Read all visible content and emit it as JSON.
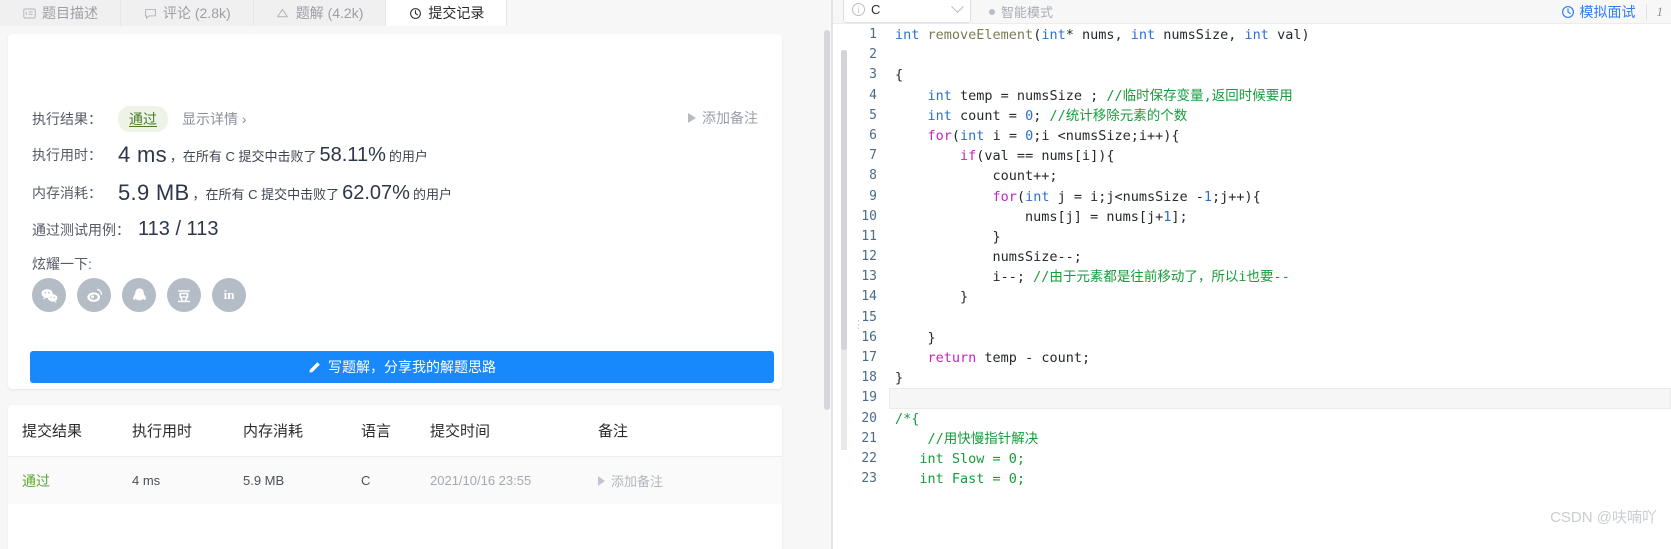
{
  "tabs": [
    {
      "label": "题目描述",
      "icon": "description-icon",
      "active": false
    },
    {
      "label": "评论 (2.8k)",
      "icon": "comment-icon",
      "active": false
    },
    {
      "label": "题解 (4.2k)",
      "icon": "solution-icon",
      "active": false
    },
    {
      "label": "提交记录",
      "icon": "history-clock-icon",
      "active": true
    }
  ],
  "result": {
    "exec_result_label": "执行结果：",
    "status_badge": "通过",
    "show_detail": "显示详情 ›",
    "add_note_top": "添加备注",
    "exec_time_label": "执行用时：",
    "exec_time_value": "4 ms",
    "exec_time_mid": "，在所有 C 提交中击败了",
    "exec_time_pct": "58.11%",
    "exec_time_suffix": "的用户",
    "mem_label": "内存消耗：",
    "mem_value": "5.9 MB",
    "mem_mid": "，在所有 C 提交中击败了",
    "mem_pct": "62.07%",
    "mem_suffix": "的用户",
    "cases_label": "通过测试用例：",
    "cases_value": "113 / 113",
    "share_label": "炫耀一下:",
    "share_icons": [
      {
        "name": "wechat-icon",
        "glyph": "wechat"
      },
      {
        "name": "weibo-icon",
        "glyph": "weibo"
      },
      {
        "name": "qq-icon",
        "glyph": "qq"
      },
      {
        "name": "douban-icon",
        "glyph": "豆"
      },
      {
        "name": "linkedin-icon",
        "glyph": "in"
      }
    ],
    "write_button": "写题解，分享我的解题思路"
  },
  "table": {
    "headers": [
      "提交结果",
      "执行用时",
      "内存消耗",
      "语言",
      "提交时间",
      "备注"
    ],
    "rows": [
      {
        "result": "通过",
        "time": "4 ms",
        "memory": "5.9 MB",
        "language": "C",
        "submitted_at": "2021/10/16 23:55",
        "note": "添加备注"
      }
    ]
  },
  "editor_header": {
    "language": "C",
    "smart_mode": "智能模式",
    "mock_interview": "模拟面试",
    "counter": "1"
  },
  "code": {
    "lines": [
      {
        "n": "1",
        "active": false,
        "tokens": [
          {
            "t": "int ",
            "c": "kw2"
          },
          {
            "t": "removeElement",
            "c": "fn"
          },
          {
            "t": "(",
            "c": "pl"
          },
          {
            "t": "int",
            "c": "kw2"
          },
          {
            "t": "* nums, ",
            "c": "pl"
          },
          {
            "t": "int",
            "c": "kw2"
          },
          {
            "t": " numsSize, ",
            "c": "pl"
          },
          {
            "t": "int",
            "c": "kw2"
          },
          {
            "t": " val)",
            "c": "pl"
          }
        ]
      },
      {
        "n": "2",
        "active": false,
        "tokens": []
      },
      {
        "n": "3",
        "active": false,
        "tokens": [
          {
            "t": "{",
            "c": "pl"
          }
        ]
      },
      {
        "n": "4",
        "active": false,
        "tokens": [
          {
            "t": "    ",
            "c": "pl"
          },
          {
            "t": "int",
            "c": "kw2"
          },
          {
            "t": " temp = numsSize ; ",
            "c": "pl"
          },
          {
            "t": "//临时保存变量,返回时候要用",
            "c": "cm"
          }
        ]
      },
      {
        "n": "5",
        "active": false,
        "tokens": [
          {
            "t": "    ",
            "c": "pl"
          },
          {
            "t": "int",
            "c": "kw2"
          },
          {
            "t": " count = ",
            "c": "pl"
          },
          {
            "t": "0",
            "c": "num"
          },
          {
            "t": "; ",
            "c": "pl"
          },
          {
            "t": "//统计移除元素的个数",
            "c": "cm"
          }
        ]
      },
      {
        "n": "6",
        "active": false,
        "tokens": [
          {
            "t": "    ",
            "c": "pl"
          },
          {
            "t": "for",
            "c": "kw"
          },
          {
            "t": "(",
            "c": "pl"
          },
          {
            "t": "int",
            "c": "kw2"
          },
          {
            "t": " i = ",
            "c": "pl"
          },
          {
            "t": "0",
            "c": "num"
          },
          {
            "t": ";i <numsSize;i++){",
            "c": "pl"
          }
        ]
      },
      {
        "n": "7",
        "active": false,
        "tokens": [
          {
            "t": "        ",
            "c": "pl"
          },
          {
            "t": "if",
            "c": "kw"
          },
          {
            "t": "(val == nums[i]){",
            "c": "pl"
          }
        ]
      },
      {
        "n": "8",
        "active": false,
        "tokens": [
          {
            "t": "            count++;",
            "c": "pl"
          }
        ]
      },
      {
        "n": "9",
        "active": false,
        "tokens": [
          {
            "t": "            ",
            "c": "pl"
          },
          {
            "t": "for",
            "c": "kw"
          },
          {
            "t": "(",
            "c": "pl"
          },
          {
            "t": "int",
            "c": "kw2"
          },
          {
            "t": " j = i;j<numsSize -",
            "c": "pl"
          },
          {
            "t": "1",
            "c": "num"
          },
          {
            "t": ";j++){",
            "c": "pl"
          }
        ]
      },
      {
        "n": "10",
        "active": false,
        "tokens": [
          {
            "t": "                nums[j] = nums[j+",
            "c": "pl"
          },
          {
            "t": "1",
            "c": "num"
          },
          {
            "t": "];",
            "c": "pl"
          }
        ]
      },
      {
        "n": "11",
        "active": false,
        "tokens": [
          {
            "t": "            }",
            "c": "pl"
          }
        ]
      },
      {
        "n": "12",
        "active": false,
        "tokens": [
          {
            "t": "            numsSize--;",
            "c": "pl"
          }
        ]
      },
      {
        "n": "13",
        "active": false,
        "tokens": [
          {
            "t": "            i--; ",
            "c": "pl"
          },
          {
            "t": "//由于元素都是往前移动了，所以i也要--",
            "c": "cm"
          }
        ]
      },
      {
        "n": "14",
        "active": false,
        "tokens": [
          {
            "t": "        }",
            "c": "pl"
          }
        ]
      },
      {
        "n": "15",
        "active": false,
        "tokens": []
      },
      {
        "n": "16",
        "active": false,
        "tokens": [
          {
            "t": "    }",
            "c": "pl"
          }
        ]
      },
      {
        "n": "17",
        "active": false,
        "tokens": [
          {
            "t": "    ",
            "c": "pl"
          },
          {
            "t": "return",
            "c": "kw"
          },
          {
            "t": " temp - count;",
            "c": "pl"
          }
        ]
      },
      {
        "n": "18",
        "active": false,
        "tokens": [
          {
            "t": "}",
            "c": "pl"
          }
        ]
      },
      {
        "n": "19",
        "active": true,
        "tokens": []
      },
      {
        "n": "20",
        "active": false,
        "tokens": [
          {
            "t": "/*{",
            "c": "cm"
          }
        ]
      },
      {
        "n": "21",
        "active": false,
        "tokens": [
          {
            "t": "    //用快慢指针解决",
            "c": "cm"
          }
        ]
      },
      {
        "n": "22",
        "active": false,
        "tokens": [
          {
            "t": "   int Slow = 0;",
            "c": "cm"
          }
        ]
      },
      {
        "n": "23",
        "active": false,
        "tokens": [
          {
            "t": "   int Fast = 0;",
            "c": "cm"
          }
        ]
      }
    ]
  },
  "watermark": "CSDN @呋喃吖",
  "colors": {
    "accent_blue": "#1789fc",
    "pass_green": "#5aa832",
    "link_blue": "#2f7df4",
    "comment_green": "#179c3c",
    "keyword_purple": "#c026c0",
    "type_blue": "#2b6fd4"
  }
}
